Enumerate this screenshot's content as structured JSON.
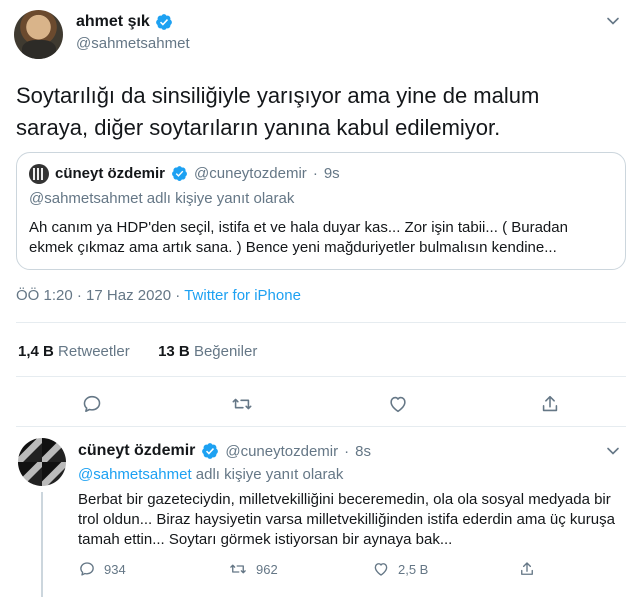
{
  "colors": {
    "accent": "#1da1f2",
    "muted": "#657786",
    "text": "#14171a",
    "border": "#ccd6dd"
  },
  "main_tweet": {
    "name": "ahmet şık",
    "handle": "@sahmetsahmet",
    "text": "Soytarılığı da sinsiliğiyle yarışıyor ama yine de malum saraya, diğer soytarıların yanına kabul edilemiyor.",
    "quote": {
      "name": "cüneyt özdemir",
      "handle": "@cuneytozdemir",
      "separator": "·",
      "age": "9s",
      "reply_to": "@sahmetsahmet adlı kişiye yanıt olarak",
      "text": "Ah canım ya HDP'den seçil, istifa et ve hala duyar kas... Zor işin tabii... ( Buradan ekmek çıkmaz ama artık sana. ) Bence yeni mağduriyetler bulmalısın kendine..."
    },
    "time": "ÖÖ 1:20",
    "date": "17 Haz 2020",
    "separator": "·",
    "source": "Twitter for iPhone",
    "retweets_count": "1,4 B",
    "retweets_label": "Retweetler",
    "likes_count": "13 B",
    "likes_label": "Beğeniler"
  },
  "reply_tweet": {
    "name": "cüneyt özdemir",
    "handle": "@cuneytozdemir",
    "separator": "·",
    "age": "8s",
    "reply_to_handle": "@sahmetsahmet",
    "reply_to_suffix": "adlı kişiye yanıt olarak",
    "text": "Berbat bir gazeteciydin, milletvekilliğini beceremedin, ola ola sosyal medyada bir trol oldun... Biraz haysiyetin varsa milletvekilliğinden istifa ederdin ama üç kuruşa tamah ettin... Soytarı görmek istiyorsan bir aynaya bak...",
    "replies": "934",
    "retweets": "962",
    "likes": "2,5 B"
  },
  "icons": [
    "verified-icon",
    "chevron-down-icon",
    "reply-icon",
    "retweet-icon",
    "like-icon",
    "share-icon"
  ]
}
